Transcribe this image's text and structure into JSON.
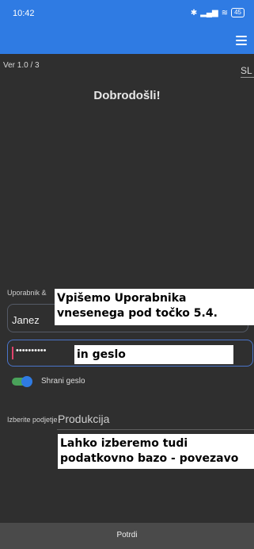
{
  "status_bar": {
    "time": "10:42",
    "battery": "45"
  },
  "header": {
    "menu_icon": "hamburger-menu-icon"
  },
  "version": "Ver 1.0 / 3",
  "language": "SL",
  "welcome": "Dobrodošli!",
  "login": {
    "user_label": "Uporabnik &",
    "user_value": "Janez",
    "password_mask": "••••••••••",
    "remember_label": "Shrani geslo",
    "remember_on": true,
    "company_label": "Izberite podjetje",
    "company_value": "Produkcija"
  },
  "annotations": {
    "user_note_line1": "Vpišemo Uporabnika",
    "user_note_line2": "vnesenega pod točko 5.4.",
    "password_note": "in geslo",
    "db_note_line1": "Lahko izberemo tudi",
    "db_note_line2": "podatkovno bazo - povezavo"
  },
  "footer": {
    "confirm_label": "Potrdi"
  },
  "colors": {
    "primary": "#2f7be3",
    "background": "#2f2f2f",
    "toggle_track": "#4aa25a",
    "caret": "#e0436b"
  }
}
